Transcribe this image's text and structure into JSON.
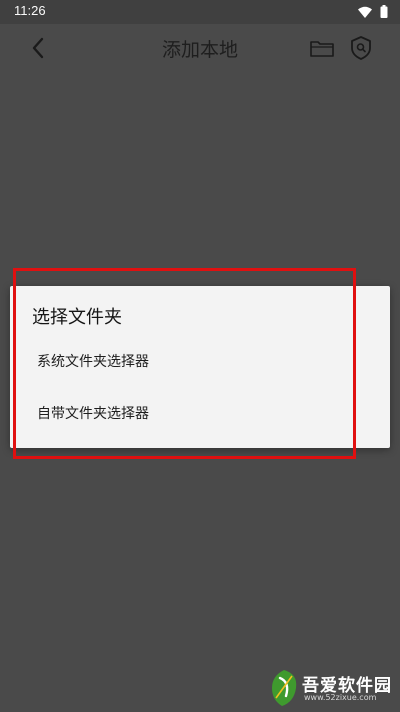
{
  "status_bar": {
    "time": "11:26",
    "icons": [
      "wifi-icon",
      "battery-icon"
    ]
  },
  "toolbar": {
    "title": "添加本地",
    "back_icon": "chevron-left-icon",
    "folder_icon": "folder-icon",
    "shield_icon": "shield-search-icon"
  },
  "dialog": {
    "title": "选择文件夹",
    "options": [
      {
        "label": "系统文件夹选择器"
      },
      {
        "label": "自带文件夹选择器"
      }
    ]
  },
  "annotation": {
    "color": "#e01010"
  },
  "watermark": {
    "name": "吾爱软件园",
    "url": "www.52zixue.com"
  },
  "colors": {
    "background": "#4a4a4a",
    "dialog": "#f3f3f3"
  }
}
